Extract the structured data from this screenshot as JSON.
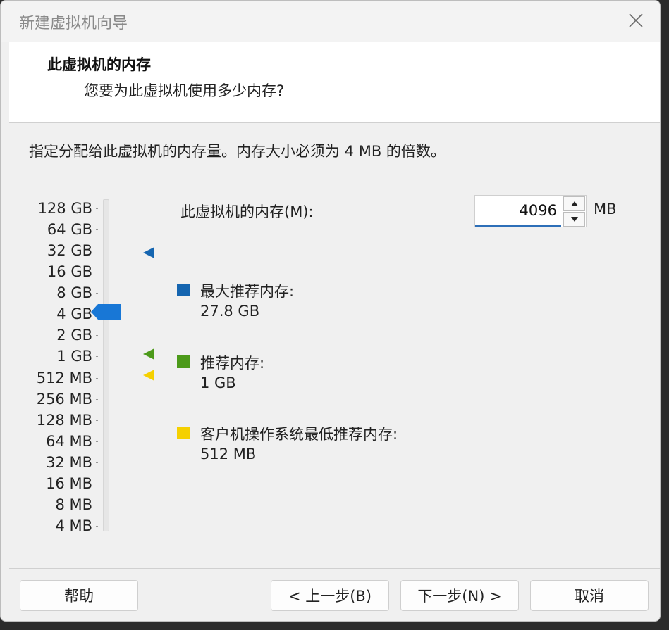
{
  "window": {
    "title": "新建虚拟机向导"
  },
  "header": {
    "title": "此虚拟机的内存",
    "subtitle": "您要为此虚拟机使用多少内存?"
  },
  "instruction": "指定分配给此虚拟机的内存量。内存大小必须为 4 MB 的倍数。",
  "scale": {
    "labels": [
      "128 GB",
      "64 GB",
      "32 GB",
      "16 GB",
      "8 GB",
      "4 GB",
      "2 GB",
      "1 GB",
      "512 MB",
      "256 MB",
      "128 MB",
      "64 MB",
      "32 MB",
      "16 MB",
      "8 MB",
      "4 MB"
    ],
    "selected": "4 GB"
  },
  "memory": {
    "label": "此虚拟机的内存(M):",
    "value": "4096",
    "unit": "MB"
  },
  "legend": {
    "max": {
      "title": "最大推荐内存:",
      "value": "27.8 GB",
      "color": "#1565b0"
    },
    "recommended": {
      "title": "推荐内存:",
      "value": "1 GB",
      "color": "#4c9a1a"
    },
    "min": {
      "title": "客户机操作系统最低推荐内存:",
      "value": "512 MB",
      "color": "#f5d000"
    }
  },
  "footer": {
    "help": "帮助",
    "back": "< 上一步(B)",
    "next": "下一步(N) >",
    "cancel": "取消"
  },
  "colors": {
    "slider_thumb": "#1877d6"
  }
}
